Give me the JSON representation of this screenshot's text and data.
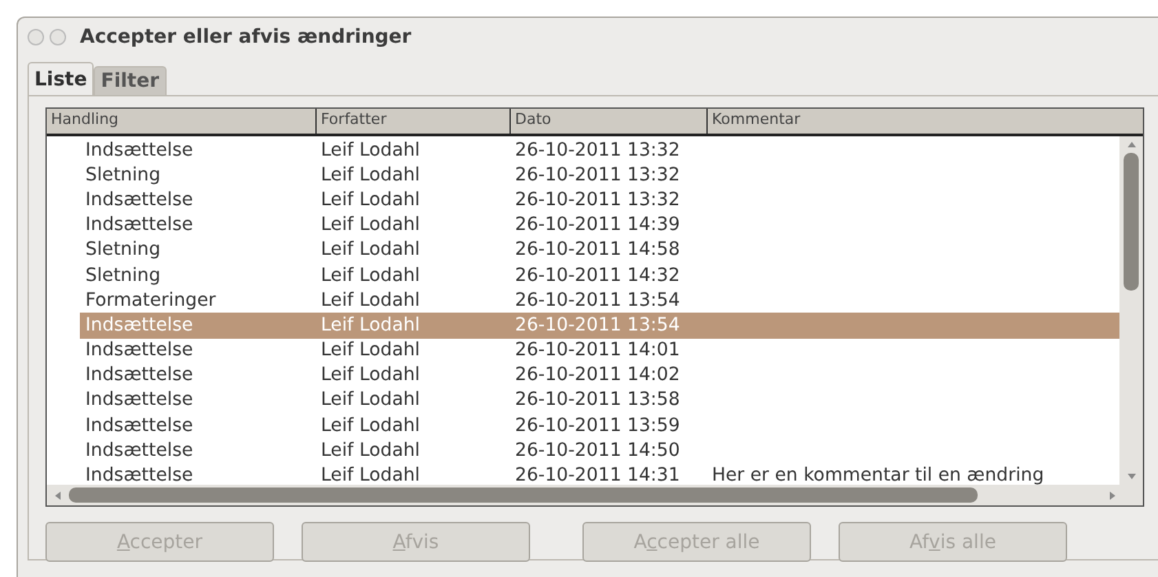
{
  "window": {
    "title": "Accepter eller afvis ændringer"
  },
  "tabs": [
    {
      "label": "Liste",
      "selected": true
    },
    {
      "label": "Filter",
      "selected": false
    }
  ],
  "table": {
    "columns": [
      "Handling",
      "Forfatter",
      "Dato",
      "Kommentar"
    ],
    "rows": [
      {
        "cells": [
          "Indsættelse",
          "Leif Lodahl",
          "26-10-2011 13:32"
        ],
        "selected": false
      },
      {
        "cells": [
          "Sletning",
          "Leif Lodahl",
          "26-10-2011 13:32"
        ],
        "selected": false
      },
      {
        "cells": [
          "Indsættelse",
          "Leif Lodahl",
          "26-10-2011 13:32"
        ],
        "selected": false
      },
      {
        "cells": [
          "Indsættelse",
          "Leif Lodahl",
          "26-10-2011 14:39"
        ],
        "selected": false
      },
      {
        "cells": [
          "Sletning",
          "Leif Lodahl",
          "26-10-2011 14:58"
        ],
        "selected": false
      },
      {
        "cells": [
          "Sletning",
          "Leif Lodahl",
          "26-10-2011 14:32"
        ],
        "selected": false
      },
      {
        "cells": [
          "Formateringer",
          "Leif Lodahl",
          "26-10-2011 13:54"
        ],
        "selected": false
      },
      {
        "cells": [
          "Indsættelse",
          "Leif Lodahl",
          "26-10-2011 13:54"
        ],
        "selected": true
      },
      {
        "cells": [
          "Indsættelse",
          "Leif Lodahl",
          "26-10-2011 14:01"
        ],
        "selected": false
      },
      {
        "cells": [
          "Indsættelse",
          "Leif Lodahl",
          "26-10-2011 14:02"
        ],
        "selected": false
      },
      {
        "cells": [
          "Indsættelse",
          "Leif Lodahl",
          "26-10-2011 13:58"
        ],
        "selected": false
      },
      {
        "cells": [
          "Indsættelse",
          "Leif Lodahl",
          "26-10-2011 13:59"
        ],
        "selected": false
      },
      {
        "cells": [
          "Indsættelse",
          "Leif Lodahl",
          "26-10-2011 14:50"
        ],
        "selected": false
      },
      {
        "cells": [
          "Indsættelse",
          "Leif Lodahl",
          "26-10-2011 14:31",
          "Her er en kommentar til en ændring"
        ],
        "selected": false
      }
    ]
  },
  "buttons": [
    {
      "key": "A",
      "post": "ccepter",
      "disabled": true
    },
    {
      "key": "A",
      "post": "fvis",
      "disabled": true
    },
    {
      "pre": "A",
      "key": "c",
      "post": "cepter alle",
      "disabled": true
    },
    {
      "pre": "Af",
      "key": "v",
      "post": "is alle",
      "disabled": true
    }
  ]
}
